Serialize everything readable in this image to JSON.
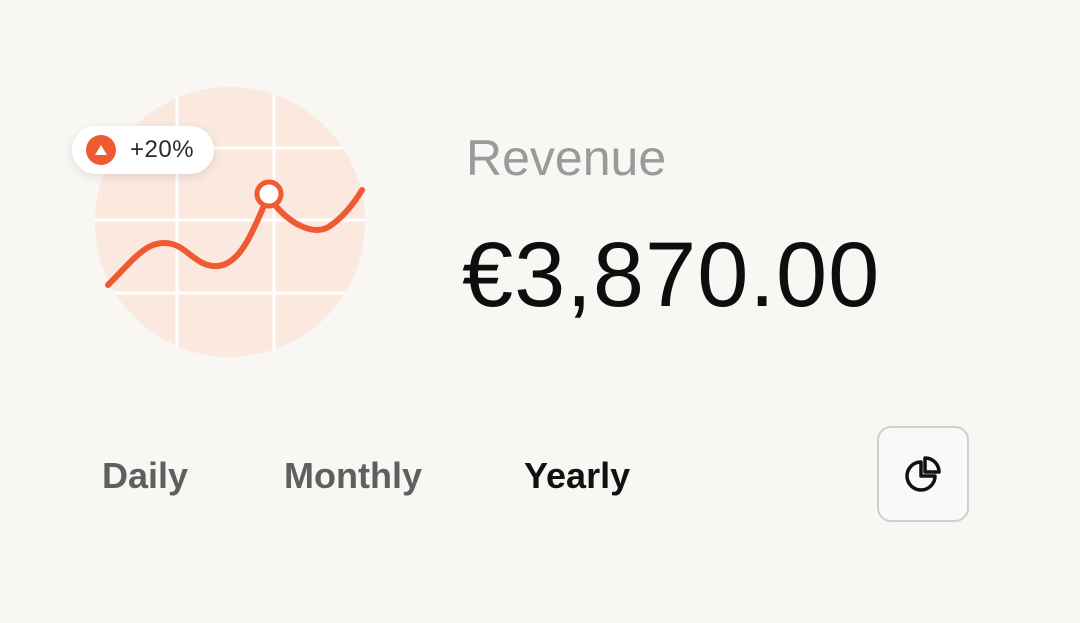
{
  "widget": {
    "badge": {
      "change_text": "+20%",
      "icon": "triangle-up-icon"
    },
    "title": "Revenue",
    "amount": "€3,870.00",
    "tabs": [
      {
        "label": "Daily",
        "active": false
      },
      {
        "label": "Monthly",
        "active": false
      },
      {
        "label": "Yearly",
        "active": true
      }
    ],
    "chart_button": {
      "icon": "pie-chart-icon"
    },
    "colors": {
      "accent": "#ef5a33",
      "chart_background": "#fbe8de",
      "text_primary": "#0e0e0e",
      "text_secondary": "#9a9a9a"
    }
  }
}
